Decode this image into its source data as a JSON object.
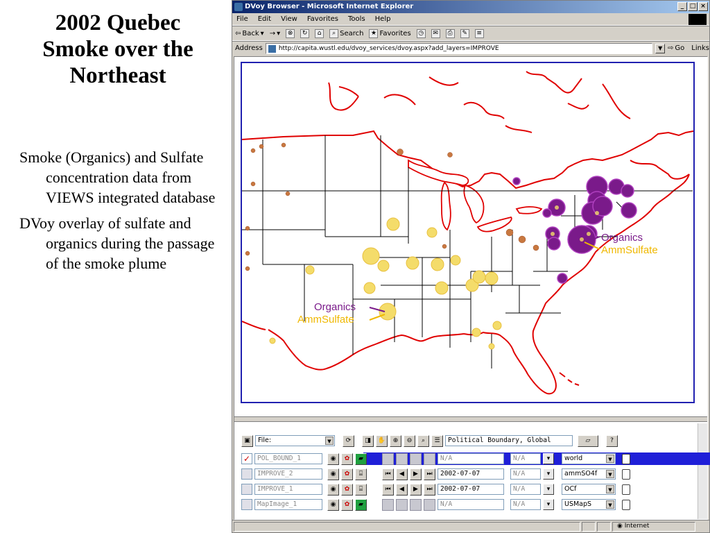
{
  "slide": {
    "title_lines": [
      "2002 Quebec",
      "Smoke over the",
      "Northeast"
    ],
    "bullets": [
      "Smoke (Organics) and Sulfate concentration data from VIEWS integrated database",
      "DVoy overlay of sulfate and organics during the passage  of the smoke plume"
    ]
  },
  "browser": {
    "title": "DVoy Browser - Microsoft Internet Explorer",
    "window_buttons": [
      "_",
      "□",
      "×"
    ],
    "menu": [
      "File",
      "Edit",
      "View",
      "Favorites",
      "Tools",
      "Help"
    ],
    "toolbar": {
      "back": "Back",
      "forward": "→",
      "search": "Search",
      "favorites": "Favorites"
    },
    "address": {
      "label": "Address",
      "url": "http://capita.wustl.edu/dvoy_services/dvoy.aspx?add_layers=IMPROVE",
      "go": "Go",
      "links": "Links"
    },
    "status": "Internet"
  },
  "map": {
    "annotations": {
      "northeast_organics": "Organics",
      "northeast_sulfate": "AmmSulfate",
      "midwest_organics": "Organics",
      "midwest_sulfate": "AmmSulfate"
    },
    "colors": {
      "frame": "#2020b0",
      "coastline": "#e00000",
      "state_lines": "#000000",
      "organics": "#7a1a8a",
      "sulfate": "#f0d040",
      "generic_site": "#c87840",
      "organics_label": "#7a1a8a",
      "sulfate_label": "#f0b800"
    }
  },
  "control_panel": {
    "file_select": "File:",
    "boundary_field": "Political Boundary, Global",
    "layers": [
      {
        "checked": true,
        "name": "POL_BOUND_1",
        "date": "N/A",
        "param": "N/A",
        "style": "world",
        "selected": true
      },
      {
        "checked": false,
        "name": "IMPROVE_2",
        "date": "2002-07-07",
        "param": "N/A",
        "style": "ammSO4f",
        "selected": false
      },
      {
        "checked": false,
        "name": "IMPROVE_1",
        "date": "2002-07-07",
        "param": "N/A",
        "style": "OCf",
        "selected": false
      },
      {
        "checked": false,
        "name": "MapImage_1",
        "date": "N/A",
        "param": "N/A",
        "style": "USMapS",
        "selected": false
      }
    ]
  }
}
